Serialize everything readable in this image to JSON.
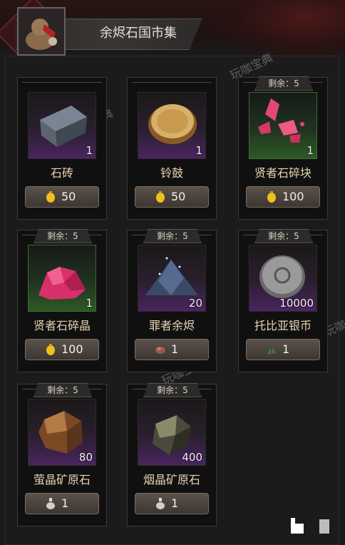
{
  "header": {
    "title": "余烬石国市集"
  },
  "watermark": "玩咖宝典",
  "items": [
    {
      "name": "石砖",
      "qty": "1",
      "price": "50",
      "currency": "gold-lamp-icon",
      "stock": null,
      "style": "purple",
      "icon": "stone-brick-icon"
    },
    {
      "name": "铃鼓",
      "qty": "1",
      "price": "50",
      "currency": "gold-lamp-icon",
      "stock": null,
      "style": "purple",
      "icon": "tambourine-icon"
    },
    {
      "name": "贤者石碎块",
      "qty": "1",
      "price": "100",
      "currency": "gold-lamp-icon",
      "stock": "剩余：5",
      "style": "green",
      "icon": "sage-stone-fragment-icon"
    },
    {
      "name": "贤者石碎晶",
      "qty": "1",
      "price": "100",
      "currency": "gold-lamp-icon",
      "stock": "剩余：5",
      "style": "green",
      "icon": "sage-stone-crystal-icon"
    },
    {
      "name": "罪者余烬",
      "qty": "20",
      "price": "1",
      "currency": "ember-ore-icon",
      "stock": "剩余：5",
      "style": "purple",
      "icon": "sinner-ember-icon"
    },
    {
      "name": "托比亚银币",
      "qty": "10000",
      "price": "1",
      "currency": "herb-icon",
      "stock": "剩余：5",
      "style": "purple",
      "icon": "silver-coin-icon"
    },
    {
      "name": "萤晶矿原石",
      "qty": "80",
      "price": "1",
      "currency": "silver-flask-icon",
      "stock": "剩余：5",
      "style": "purple",
      "icon": "firefly-ore-icon"
    },
    {
      "name": "烟晶矿原石",
      "qty": "400",
      "price": "1",
      "currency": "silver-flask-icon",
      "stock": "剩余：5",
      "style": "purple",
      "icon": "smoke-ore-icon"
    }
  ]
}
